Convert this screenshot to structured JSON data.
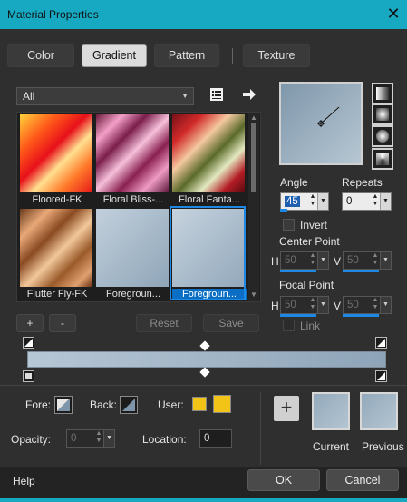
{
  "window": {
    "title": "Material Properties",
    "close_glyph": "✕"
  },
  "tabs": [
    {
      "label": "Color"
    },
    {
      "label": "Gradient",
      "active": true
    },
    {
      "label": "Pattern"
    },
    {
      "label": "Texture"
    }
  ],
  "category": {
    "selected": "All"
  },
  "gallery": {
    "items": [
      {
        "label": "Floored-FK"
      },
      {
        "label": "Floral Bliss-..."
      },
      {
        "label": "Floral Fanta..."
      },
      {
        "label": "Flutter Fly-FK"
      },
      {
        "label": "Foregroun..."
      },
      {
        "label": "Foregroun...",
        "selected": true
      }
    ]
  },
  "gallery_buttons": {
    "add": "+",
    "remove": "-",
    "reset": "Reset",
    "save": "Save"
  },
  "angle": {
    "label": "Angle",
    "value": "45"
  },
  "repeats": {
    "label": "Repeats",
    "value": "0"
  },
  "invert": {
    "label": "Invert",
    "checked": false
  },
  "center_point": {
    "label": "Center Point",
    "h_label": "H",
    "h_value": "50",
    "v_label": "V",
    "v_value": "50"
  },
  "focal_point": {
    "label": "Focal Point",
    "h_label": "H",
    "h_value": "50",
    "v_label": "V",
    "v_value": "50"
  },
  "link": {
    "label": "Link",
    "checked": false
  },
  "gradient_colors": {
    "start": "#b6c7d6",
    "end": "#8ea4b8"
  },
  "fore": {
    "label": "Fore:"
  },
  "back": {
    "label": "Back:"
  },
  "user": {
    "label": "User:",
    "color1": "#f2c418",
    "color2": "#f2c418"
  },
  "opacity": {
    "label": "Opacity:",
    "value": "0"
  },
  "location": {
    "label": "Location:",
    "value": "0"
  },
  "current": {
    "label": "Current"
  },
  "previous": {
    "label": "Previous"
  },
  "footer": {
    "help": "Help",
    "ok": "OK",
    "cancel": "Cancel"
  },
  "colors": {
    "title_bar": "#17a9c2",
    "selection": "#1e88e5",
    "background": "#2f2f2f"
  }
}
